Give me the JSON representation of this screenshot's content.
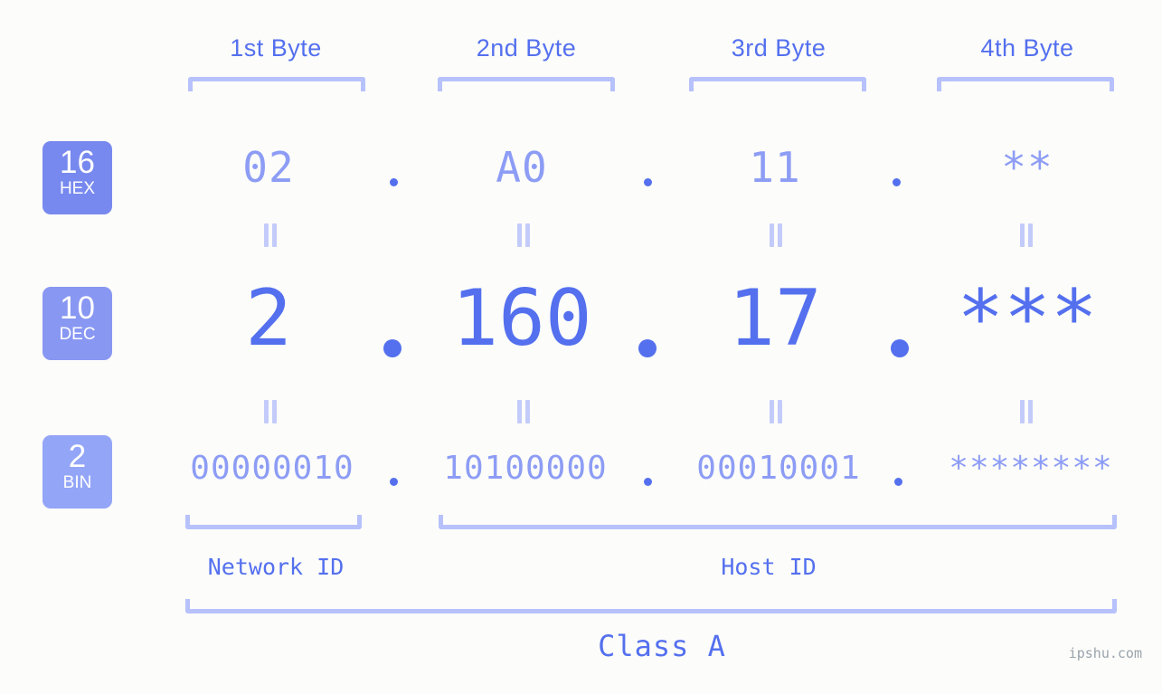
{
  "page": {
    "background_color": "#fcfdfa",
    "accent_color": "#5570ef",
    "muted_accent_color": "#8d9cf4",
    "bracket_color": "#b7c1fb",
    "watermark": "ipshu.com"
  },
  "byte_headers": [
    {
      "label": "1st Byte"
    },
    {
      "label": "2nd Byte"
    },
    {
      "label": "3rd Byte"
    },
    {
      "label": "4th Byte"
    }
  ],
  "radix_badges": [
    {
      "number": "16",
      "name": "HEX",
      "color": "#7788ef"
    },
    {
      "number": "10",
      "name": "DEC",
      "color": "#8897f2"
    },
    {
      "number": "2",
      "name": "BIN",
      "color": "#93a5f6"
    }
  ],
  "rows": {
    "hex": {
      "radix_number": "16",
      "radix_name": "HEX",
      "values": [
        "02",
        "A0",
        "11",
        "**"
      ],
      "separator": "."
    },
    "dec": {
      "radix_number": "10",
      "radix_name": "DEC",
      "values": [
        "2",
        "160",
        "17",
        "***"
      ],
      "separator": "."
    },
    "bin": {
      "radix_number": "2",
      "radix_name": "BIN",
      "values": [
        "00000010",
        "10100000",
        "00010001",
        "********"
      ],
      "separator": "."
    }
  },
  "equality_marks": {
    "glyph": "=",
    "count_per_row": 4
  },
  "id_labels": [
    {
      "label": "Network ID"
    },
    {
      "label": "Host ID"
    }
  ],
  "class_label": "Class A"
}
